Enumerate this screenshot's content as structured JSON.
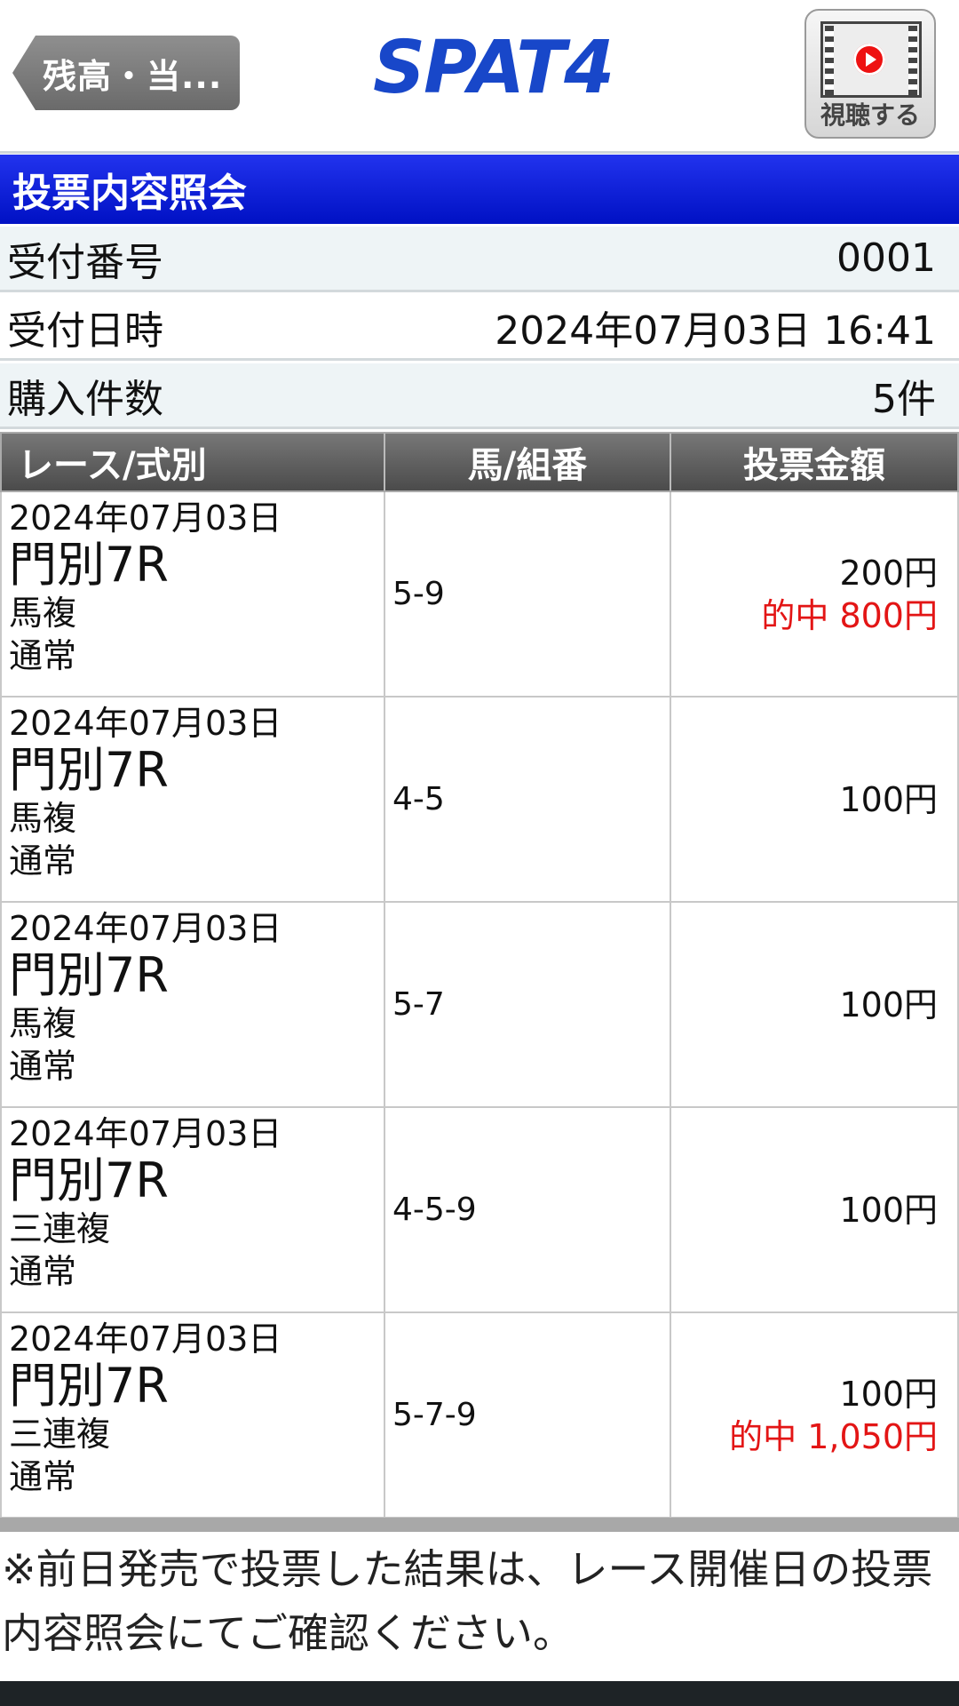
{
  "header": {
    "back_label": "残高・当...",
    "logo_text": "SPAT4",
    "watch_label": "視聴する"
  },
  "title": "投票内容照会",
  "info": {
    "receipt_no_label": "受付番号",
    "receipt_no_value": "0001",
    "receipt_datetime_label": "受付日時",
    "receipt_datetime_value": "2024年07月03日 16:41",
    "purchase_count_label": "購入件数",
    "purchase_count_value": "5件"
  },
  "table": {
    "headers": [
      "レース/式別",
      "馬/組番",
      "投票金額"
    ],
    "rows": [
      {
        "date": "2024年07月03日",
        "race": "門別7R",
        "bet_type": "馬複",
        "method": "通常",
        "combo": "5-9",
        "amount": "200円",
        "win": "的中  800円"
      },
      {
        "date": "2024年07月03日",
        "race": "門別7R",
        "bet_type": "馬複",
        "method": "通常",
        "combo": "4-5",
        "amount": "100円",
        "win": ""
      },
      {
        "date": "2024年07月03日",
        "race": "門別7R",
        "bet_type": "馬複",
        "method": "通常",
        "combo": "5-7",
        "amount": "100円",
        "win": ""
      },
      {
        "date": "2024年07月03日",
        "race": "門別7R",
        "bet_type": "三連複",
        "method": "通常",
        "combo": "4-5-9",
        "amount": "100円",
        "win": ""
      },
      {
        "date": "2024年07月03日",
        "race": "門別7R",
        "bet_type": "三連複",
        "method": "通常",
        "combo": "5-7-9",
        "amount": "100円",
        "win": "的中  1,050円"
      }
    ]
  },
  "note": "※前日発売で投票した結果は、レース開催日の投票内容照会にてご確認ください。",
  "colors": {
    "title_bar": "#0011c4",
    "logo": "#1847c9",
    "win_text": "#e31515",
    "row_alt": "#eef4f6"
  }
}
